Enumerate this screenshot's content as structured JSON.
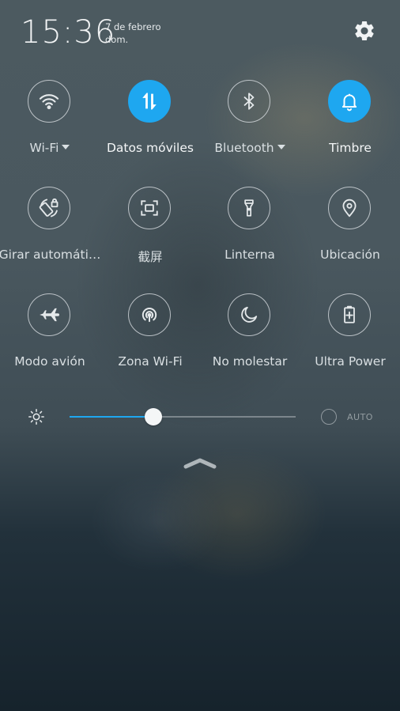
{
  "status": {
    "time": "15:36",
    "date": "7 de febrero",
    "day": "dom.",
    "settings_icon": "gear-icon"
  },
  "tiles": [
    {
      "label": "Wi-Fi",
      "icon": "wifi-icon",
      "active": false,
      "dropdown": true
    },
    {
      "label": "Datos móviles",
      "icon": "mobile-data-icon",
      "active": true,
      "dropdown": false
    },
    {
      "label": "Bluetooth",
      "icon": "bluetooth-icon",
      "active": false,
      "dropdown": true
    },
    {
      "label": "Timbre",
      "icon": "bell-icon",
      "active": true,
      "dropdown": false
    },
    {
      "label": "Girar automáti…",
      "icon": "auto-rotate-lock-icon",
      "active": false,
      "dropdown": false
    },
    {
      "label": "截屏",
      "icon": "screenshot-icon",
      "active": false,
      "dropdown": false
    },
    {
      "label": "Linterna",
      "icon": "flashlight-icon",
      "active": false,
      "dropdown": false
    },
    {
      "label": "Ubicación",
      "icon": "location-icon",
      "active": false,
      "dropdown": false
    },
    {
      "label": "Modo avión",
      "icon": "airplane-icon",
      "active": false,
      "dropdown": false
    },
    {
      "label": "Zona Wi-Fi",
      "icon": "hotspot-icon",
      "active": false,
      "dropdown": false
    },
    {
      "label": "No molestar",
      "icon": "moon-icon",
      "active": false,
      "dropdown": false
    },
    {
      "label": "Ultra Power",
      "icon": "battery-plus-icon",
      "active": false,
      "dropdown": false
    }
  ],
  "brightness": {
    "level": 0.37,
    "auto_label": "AUTO",
    "auto_enabled": false,
    "icon": "brightness-icon"
  },
  "colors": {
    "accent": "#1ea7f0"
  }
}
